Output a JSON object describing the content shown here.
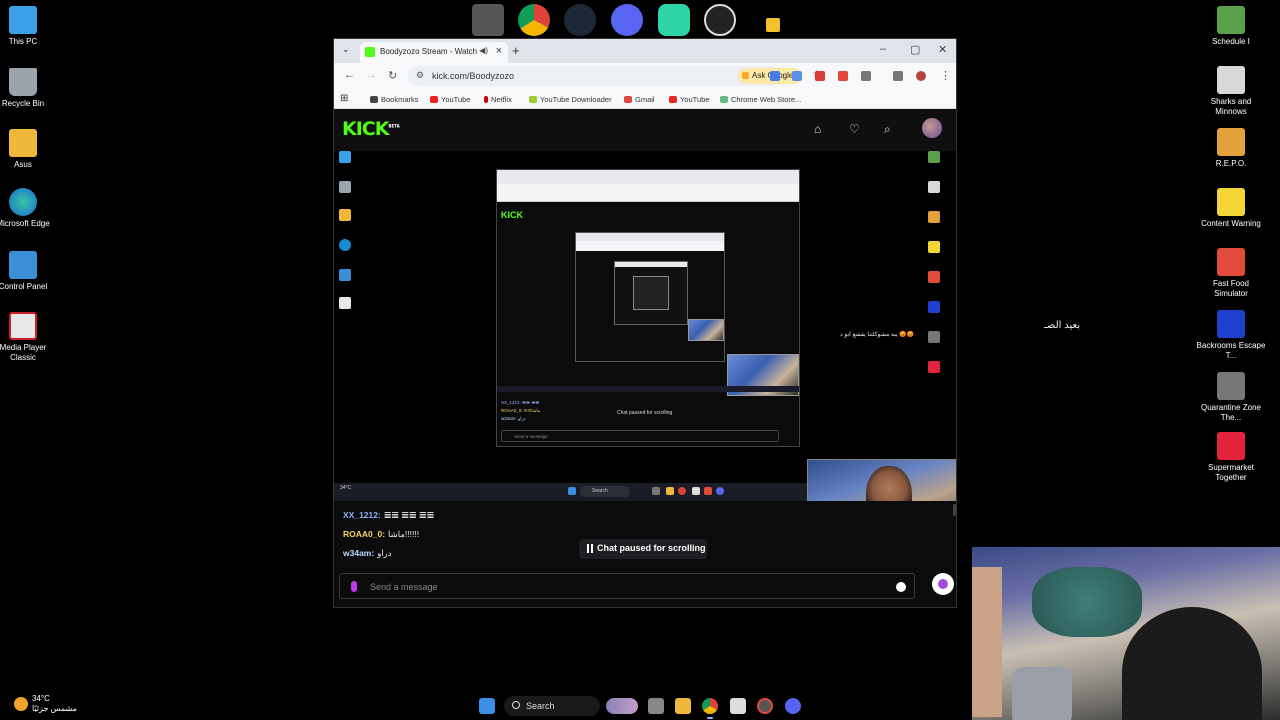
{
  "desktop_icons_left": [
    {
      "label": "This PC",
      "color": "#3aa0e8"
    },
    {
      "label": "Recycle Bin",
      "color": "#9aa4ad"
    },
    {
      "label": "Asus",
      "color": "#f0b83a"
    },
    {
      "label": "Microsoft Edge",
      "color": "#1b8ad6"
    },
    {
      "label": "Control Panel",
      "color": "#3b8fd9"
    },
    {
      "label": "Media Player Classic",
      "color": "#e8e8e8"
    }
  ],
  "desktop_icons_right": [
    {
      "label": "Schedule I",
      "color": "#5ba14b"
    },
    {
      "label": "Sharks and Minnows",
      "color": "#d8d8d8"
    },
    {
      "label": "R.E.P.O.",
      "color": "#e2a13b"
    },
    {
      "label": "Content Warning",
      "color": "#f3d536"
    },
    {
      "label": "Fast Food Simulator",
      "color": "#e24a3b"
    },
    {
      "label": "Backrooms Escape T...",
      "color": "#1f3fd1"
    },
    {
      "label": "Quarantine Zone The...",
      "color": "#777777"
    },
    {
      "label": "Supermarket Together",
      "color": "#e2233b"
    }
  ],
  "browser": {
    "tab_title": "Boodyzozo Stream - Watch",
    "url": "kick.com/Boodyzozo",
    "ask_google": "Ask Google",
    "bookmarks": [
      "Bookmarks",
      "YouTube",
      "Netflix",
      "YouTube Downloader",
      "Gmail",
      "YouTube",
      "Chrome Web Store..."
    ]
  },
  "kick": {
    "logo": "KICK",
    "logo_badge": "BETA",
    "video": {
      "nested_paused": "Chat paused for scrolling",
      "nested_send": "Send a message",
      "nested_logo": "KICK",
      "nested_chat": [
        "XX_1212: 𝌆𝌆 𝌆𝌆",
        "ROAA0_0: !!!!!!ماشا",
        "w34am: دراو"
      ],
      "overlay_arabic": "😡😡 يبه مشوكلتنا يقشع ابو د",
      "taskbar_weather": "34°C",
      "taskbar_search": "Search"
    },
    "chat": {
      "messages": [
        {
          "user": "XX_1212:",
          "user_color": "#8fb2ff",
          "text": "𝌆𝌆 𝌆𝌆 𝌆𝌆"
        },
        {
          "user": "ROAA0_0:",
          "user_color": "#f5d36b",
          "text": "ماشا!!!!!!"
        },
        {
          "user": "w34am:",
          "user_color": "#b6ddff",
          "text": "دراو"
        }
      ],
      "paused_label": "Chat paused for scrolling",
      "send_placeholder": "Send a message"
    }
  },
  "overlay_text_right": "بعيد الصـ",
  "taskbar": {
    "weather_temp": "34°C",
    "weather_desc": "مشمس جزئيًا",
    "search_label": "Search"
  },
  "colors": {
    "kick_green": "#53fc18",
    "windows_blue": "#3a8ee6"
  }
}
